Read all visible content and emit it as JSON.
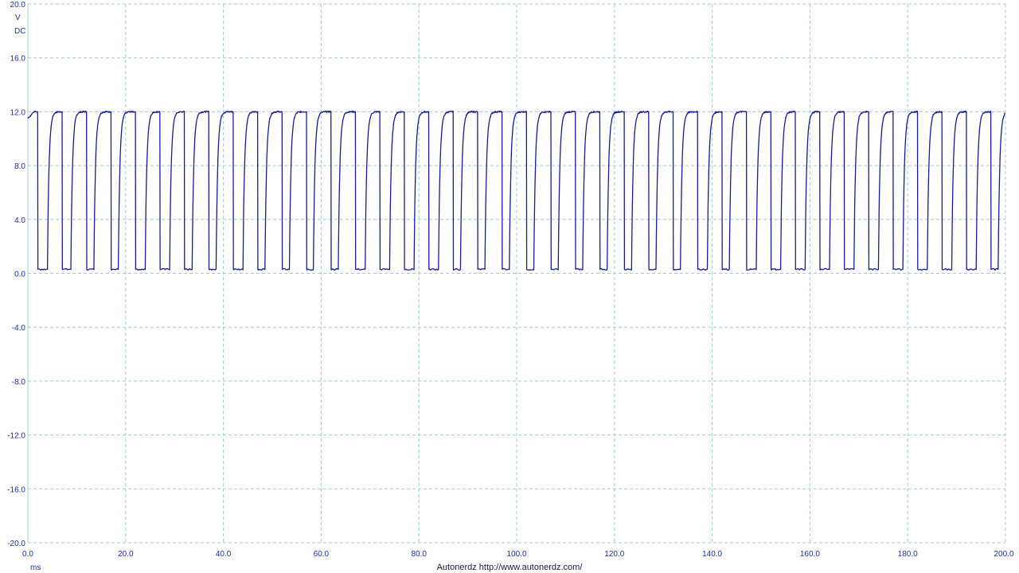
{
  "chart_data": {
    "type": "line",
    "title": "",
    "ylabel_unit": "V",
    "ylabel_coupling": "DC",
    "xlabel": "ms",
    "credit": "Autonerdz  http://www.autonerdz.com/",
    "xlim": [
      0,
      200
    ],
    "ylim": [
      -20,
      20
    ],
    "x_ticks": [
      "0.0",
      "20.0",
      "40.0",
      "60.0",
      "80.0",
      "100.0",
      "120.0",
      "140.0",
      "160.0",
      "180.0",
      "200.0"
    ],
    "y_ticks": [
      "20.0",
      "16.0",
      "12.0",
      "8.0",
      "4.0",
      "0.0",
      "-4.0",
      "-8.0",
      "-12.0",
      "-16.0",
      "-20.0"
    ],
    "grid": true,
    "series": [
      {
        "color": "#1a1a9c",
        "waveform": "square",
        "high_level": 12.0,
        "low_level": 0.3,
        "initial_level": 11.5,
        "high_to_low_transitions_ms": [
          2.0,
          7.0,
          12.0,
          17.0,
          22.0,
          27.0,
          32.0,
          37.0,
          42.0,
          47.0,
          52.0,
          57.0,
          62.0,
          67.0,
          72.0,
          77.0,
          82.0,
          87.0,
          92.0,
          97.0,
          102.0,
          107.0,
          112.0,
          117.0,
          122.0,
          127.0,
          132.0,
          137.0,
          142.0,
          147.0,
          152.0,
          157.0,
          162.0,
          167.0,
          172.0,
          177.0,
          182.0,
          187.0,
          192.0,
          197.0
        ],
        "low_to_high_transitions_ms": [
          4.0,
          8.8,
          13.5,
          18.5,
          24.0,
          29.0,
          33.6,
          38.5,
          44.0,
          48.5,
          53.5,
          58.4,
          63.5,
          69.0,
          74.0,
          79.0,
          84.0,
          88.5,
          93.5,
          98.5,
          103.5,
          108.5,
          113.5,
          118.5,
          123.5,
          128.5,
          133.5,
          139.0,
          143.5,
          149.0,
          154.0,
          159.0,
          164.0,
          169.0,
          174.0,
          179.0,
          184.0,
          189.0,
          194.0,
          198.5
        ]
      }
    ]
  }
}
